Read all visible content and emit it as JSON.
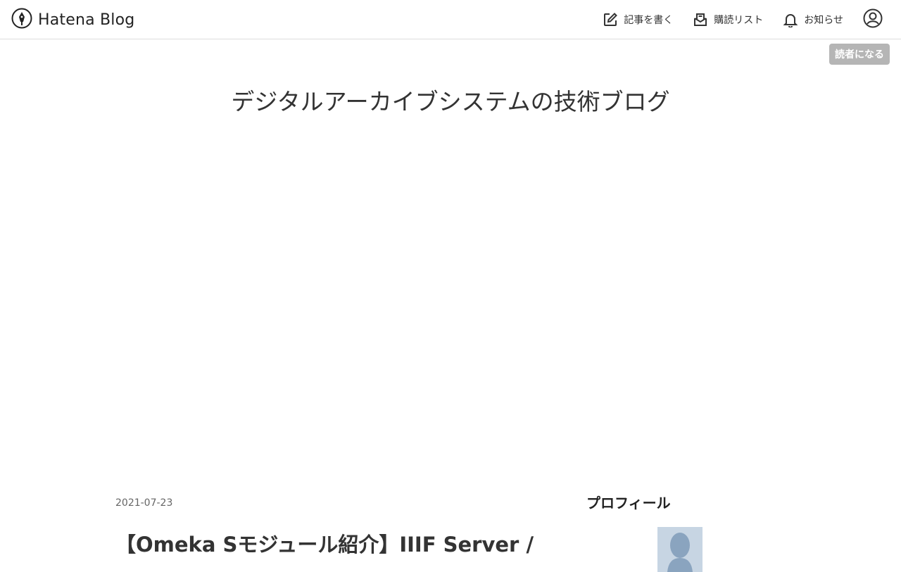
{
  "header": {
    "brand": "Hatena Blog",
    "nav": {
      "write": "記事を書く",
      "reading_list": "購読リスト",
      "notifications": "お知らせ"
    }
  },
  "subscribe_button": "読者になる",
  "blog": {
    "title": "デジタルアーカイブシステムの技術ブログ"
  },
  "entry": {
    "date": "2021-07-23",
    "title": "【Omeka Sモジュール紹介】IIIF Server /"
  },
  "sidebar": {
    "profile_heading": "プロフィール"
  },
  "icons": [
    "hatena-pen-icon",
    "edit-icon",
    "reading-list-icon",
    "bell-icon",
    "user-circle-icon",
    "avatar-silhouette"
  ]
}
